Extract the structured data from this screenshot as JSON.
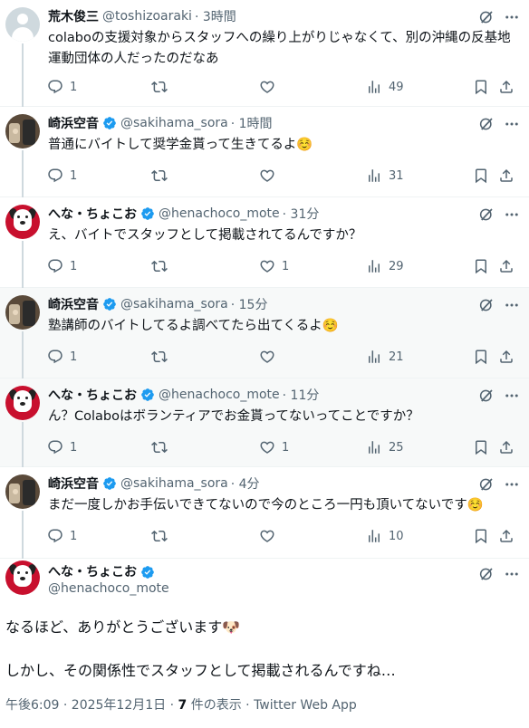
{
  "tweets": [
    {
      "name": "荒木俊三",
      "handle": "@toshizoaraki",
      "time": "· 3時間",
      "text": "colaboの支援対象からスタッフへの繰り上がりじゃなくて、別の沖縄の反基地運動団体の人だったのだなあ",
      "replies": "1",
      "retweets": "",
      "likes": "",
      "views": "49"
    },
    {
      "name": "崎浜空音",
      "handle": "@sakihama_sora",
      "time": "· 1時間",
      "text": "普通にバイトして奨学金貰って生きてるよ☺️",
      "replies": "1",
      "retweets": "",
      "likes": "",
      "views": "31"
    },
    {
      "name": "へな・ちょこお",
      "handle": "@henachoco_mote",
      "time": "· 31分",
      "text": "え、バイトでスタッフとして掲載されてるんですか？",
      "replies": "1",
      "retweets": "",
      "likes": "1",
      "views": "29"
    },
    {
      "name": "崎浜空音",
      "handle": "@sakihama_sora",
      "time": "· 15分",
      "text": "塾講師のバイトしてるよ調べてたら出てくるよ☺️",
      "replies": "1",
      "retweets": "",
      "likes": "",
      "views": "21"
    },
    {
      "name": "へな・ちょこお",
      "handle": "@henachoco_mote",
      "time": "· 11分",
      "text": "ん？Colaboはボランティアでお金貰ってないってことですか？",
      "replies": "1",
      "retweets": "",
      "likes": "1",
      "views": "25"
    },
    {
      "name": "崎浜空音",
      "handle": "@sakihama_sora",
      "time": "· 4分",
      "text": "まだ一度しかお手伝いできてないので今のところ一円も頂いてないです☺️",
      "replies": "1",
      "retweets": "",
      "likes": "",
      "views": "10"
    }
  ],
  "main_tweet": {
    "name": "へな・ちょこお",
    "handle": "@henachoco_mote",
    "line1": "なるほど、ありがとうございます🐶",
    "line2": "しかし、その関係性でスタッフとして掲載されるんですね…",
    "timestamp": "午後6:09 · 2025年12月1日 · ",
    "view_count": "7",
    "view_label": " 件の表示 · ",
    "source": "Twitter Web App"
  },
  "icons": {
    "reply": "reply-icon",
    "retweet": "retweet-icon",
    "like": "heart-icon",
    "views": "views-icon",
    "bookmark": "bookmark-icon",
    "share": "share-icon",
    "grok": "grok-icon",
    "more": "more-icon",
    "verified": "verified-badge-icon"
  },
  "colors": {
    "accent": "#1d9bf0",
    "muted": "#536471",
    "text": "#0f1419",
    "alt_bg": "#f7f9f9"
  }
}
